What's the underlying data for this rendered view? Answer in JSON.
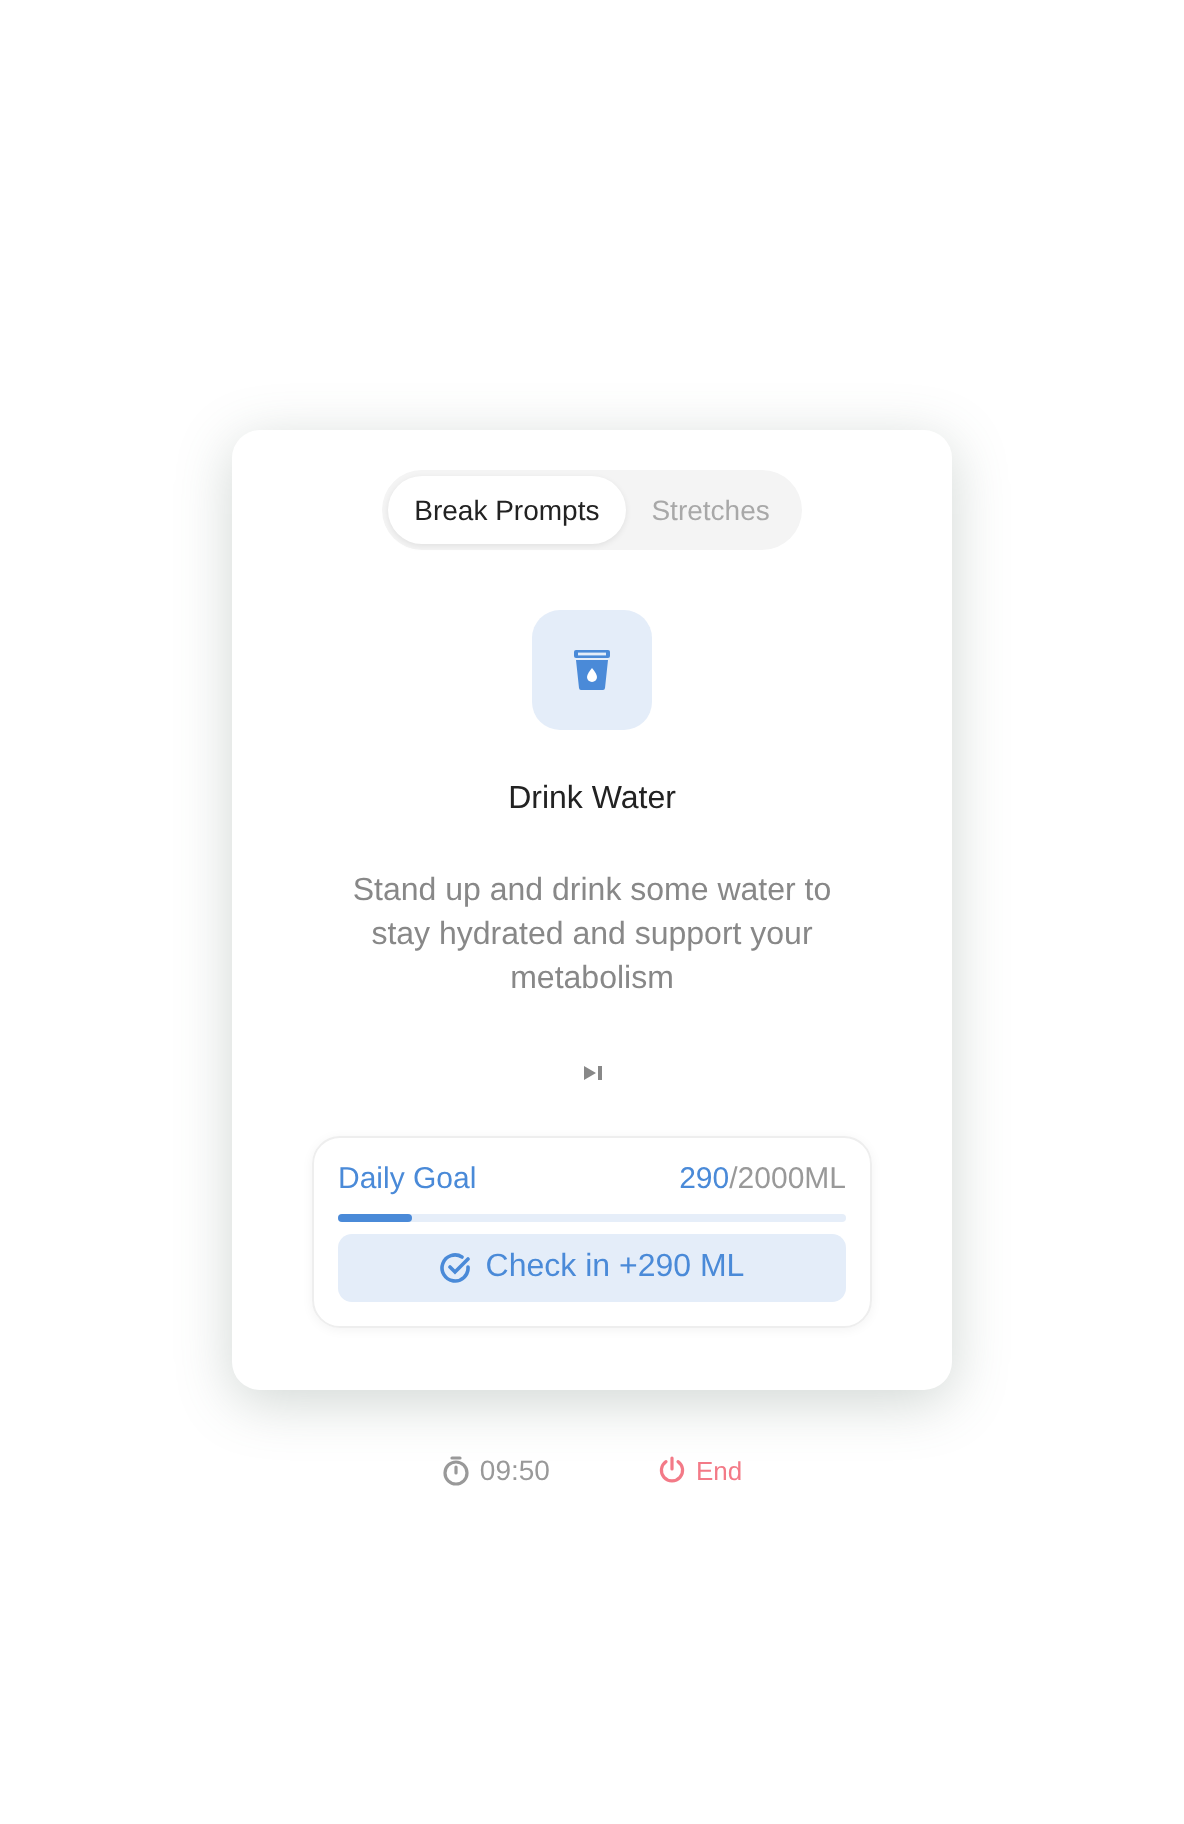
{
  "tabs": [
    {
      "label": "Break Prompts",
      "selected": true
    },
    {
      "label": "Stretches",
      "selected": false
    }
  ],
  "prompt": {
    "title": "Drink Water",
    "description": "Stand up and drink some water to stay hydrated and support your metabolism"
  },
  "goal": {
    "label": "Daily Goal",
    "current": "290",
    "total": "/2000ML",
    "level": 0.145,
    "button": "Check in +290 ML"
  },
  "footer": {
    "timer": "09:50",
    "end": "End"
  }
}
